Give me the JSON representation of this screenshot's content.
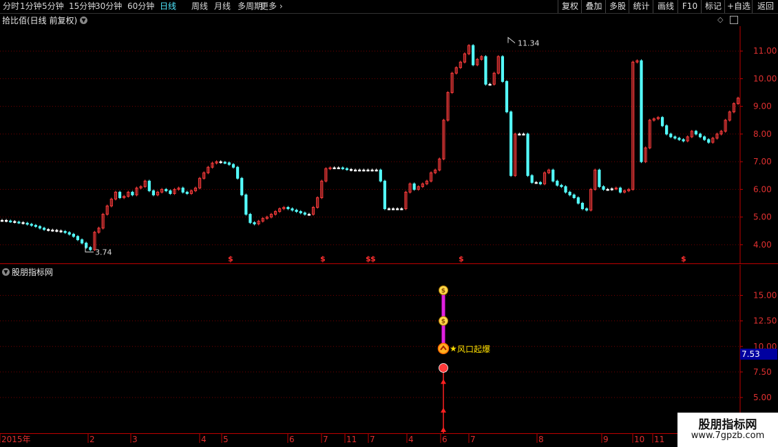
{
  "toolbar": {
    "periods": [
      "分时",
      "1分钟",
      "5分钟",
      "15分钟",
      "30分钟",
      "60分钟",
      "日线",
      "周线",
      "月线",
      "多周期",
      "更多"
    ],
    "active_period": "日线",
    "right_buttons": [
      "复权",
      "叠加",
      "多股",
      "统计",
      "画线",
      "F10",
      "标记",
      "+自选",
      "返回"
    ]
  },
  "stock": {
    "title": "拾比佰(日线 前复权)"
  },
  "indicator": {
    "title": "股朋指标网",
    "signal_label": "风口起爆",
    "last_value": "7.53"
  },
  "price_axis": {
    "labels": [
      "11.00",
      "10.00",
      "9.00",
      "8.00",
      "7.00",
      "6.00",
      "5.00",
      "4.00"
    ],
    "ylim": [
      3.4,
      11.8
    ]
  },
  "indicator_axis": {
    "labels": [
      "15.00",
      "12.50",
      "10.00",
      "7.50",
      "5.00"
    ],
    "ylim": [
      1.5,
      18.0
    ]
  },
  "annotations": {
    "high": "11.34",
    "low": "3.74"
  },
  "date_axis": {
    "labels": [
      "2015年",
      "2",
      "3",
      "4",
      "5",
      "6",
      "7",
      "11",
      "7",
      "4",
      "6",
      "7",
      "8",
      "9",
      "10",
      "11"
    ]
  },
  "watermark": {
    "name": "股朋指标网",
    "url": "www.7gpzb.com"
  },
  "colors": {
    "up": "#ff3c3c",
    "down": "#54ffff",
    "flat": "#ffffff",
    "grid": "#7a0000",
    "axis": "#c00000"
  },
  "icons": [
    "money-bag-icon",
    "fire-icon",
    "flame-icon",
    "star-icon",
    "up-arrow-icon",
    "collapse-icon",
    "dollar-marker-icon"
  ]
}
